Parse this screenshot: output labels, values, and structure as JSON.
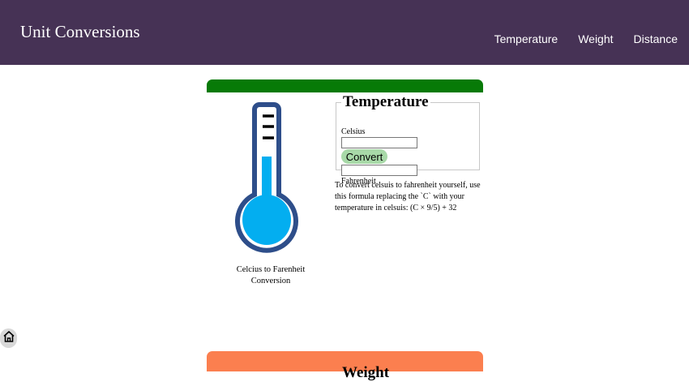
{
  "header": {
    "title": "Unit Conversions",
    "nav": [
      "Temperature",
      "Weight",
      "Distance"
    ]
  },
  "temperature": {
    "image_caption": "Celcius to Farenheit Conversion",
    "legend": "Temperature",
    "celsius_label": "Celsius",
    "celsius_value": "",
    "convert_label": "Convert",
    "fahrenheit_value": "",
    "fahrenheit_label": "Fahrenheit",
    "formula_text": "To convert celsuis to fahrenheit yourself, use this formula replacing the `C` with your temperature in celsuis: (C × 9/5) + 32",
    "bar_color": "#077a07",
    "button_color": "#a8d9a8"
  },
  "weight": {
    "title": "Weight",
    "bar_color": "#fb7f4f"
  },
  "colors": {
    "header_bg": "#463255",
    "thermometer_outline": "#2e4e8a",
    "thermometer_fluid": "#03aef0"
  },
  "icons": {
    "home": "home-icon",
    "thermometer": "thermometer-icon"
  }
}
